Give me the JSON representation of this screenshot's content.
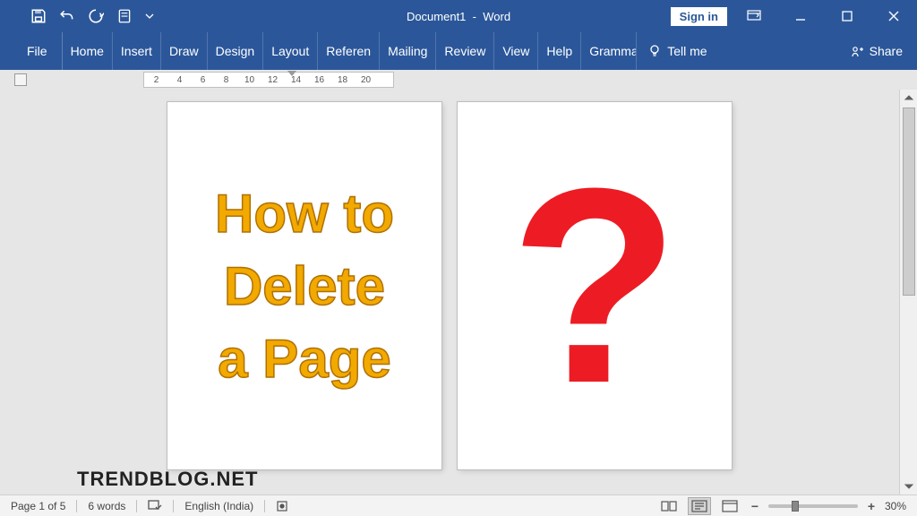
{
  "title": {
    "document": "Document1",
    "app": "Word"
  },
  "signin": "Sign in",
  "ribbon": {
    "file": "File",
    "tabs": [
      "Home",
      "Insert",
      "Draw",
      "Design",
      "Layout",
      "Referen",
      "Mailing",
      "Review",
      "View",
      "Help",
      "Gramma"
    ],
    "tellme": "Tell me",
    "share": "Share"
  },
  "ruler": {
    "marks": [
      "2",
      "4",
      "6",
      "8",
      "10",
      "12",
      "14",
      "16",
      "18",
      "20"
    ]
  },
  "page1": {
    "line1": "How to",
    "line2": "Delete",
    "line3": "a Page"
  },
  "page2": {
    "glyph": "?"
  },
  "status": {
    "page": "Page 1 of 5",
    "words": "6 words",
    "lang": "English (India)",
    "zoom": "30%"
  },
  "watermark": "TRENDBLOG.NET"
}
